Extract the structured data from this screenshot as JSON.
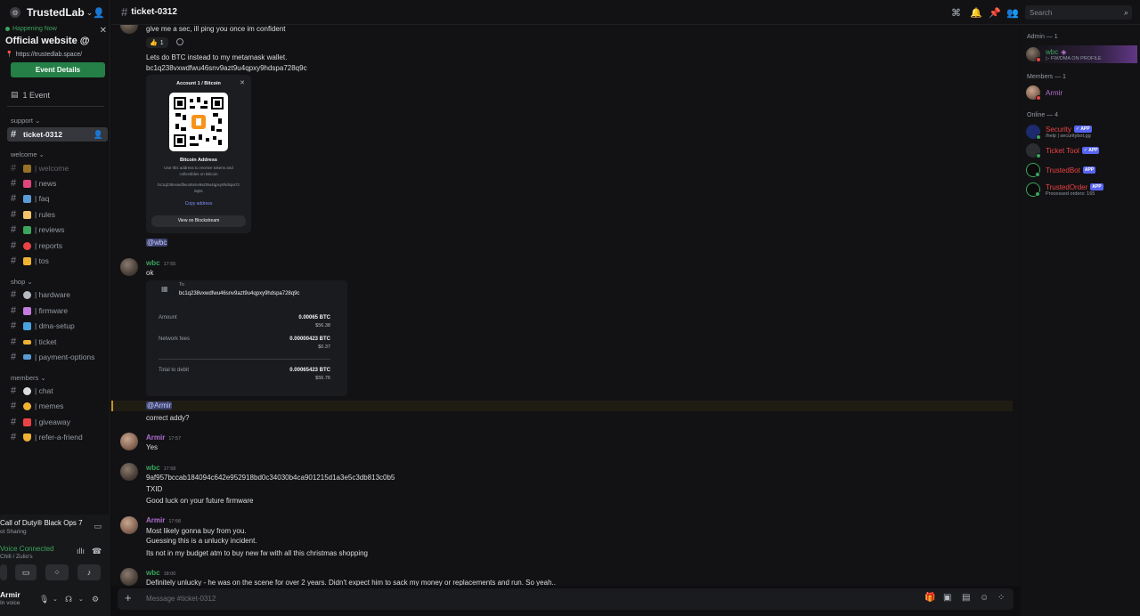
{
  "server": {
    "name": "TrustedLab"
  },
  "event": {
    "status": "Happening Now",
    "title": "Official website @",
    "url": "https://trustedlab.space/",
    "button": "Event Details",
    "count": "1 Event"
  },
  "categories": {
    "support": "support",
    "welcome": "welcome",
    "shop": "shop",
    "members": "members"
  },
  "channels": {
    "active": "ticket-0312",
    "welcome": [
      "| welcome",
      "| news",
      "| faq",
      "| rules",
      "| reviews",
      "| reports",
      "| tos"
    ],
    "shop": [
      "| hardware",
      "| firmware",
      "| dma-setup",
      "| ticket",
      "| payment-options"
    ],
    "members": [
      "| chat",
      "| memes",
      "| giveaway",
      "| refer-a-friend"
    ]
  },
  "activity": {
    "game": "Call of Duty® Black Ops 7",
    "sub": "ot Sharing"
  },
  "voice": {
    "status": "Voice Connected",
    "channel": "Chill / Zulio's"
  },
  "user": {
    "name": "Armir",
    "status": "In voice"
  },
  "header": {
    "channel": "ticket-0312",
    "search_placeholder": "Search"
  },
  "messages": {
    "m1": "give me a sec, ill ping you once im confident",
    "reaction_count": "1",
    "m2": "Lets do BTC instead to my metamask wallet.",
    "m3": "bc1q238vxwdfwu46snv9azt9u4qpxy9hdspa728q9c",
    "wallet": {
      "title": "Account 1 / Bitcoin",
      "label": "Bitcoin Address",
      "desc": "Use this address to receive tokens and collectibles on Bitcoin",
      "address": "bc1q238vxwdfwu46snv9azt9u4qpxy9hdspa728q9c",
      "copy": "Copy address",
      "view": "View on Blockstream"
    },
    "mention1": "@wbc",
    "wbc1_author": "wbc",
    "wbc1_time": "17:55",
    "wbc1_text": "ok",
    "tx": {
      "to_label": "To",
      "to_addr": "bc1q238vxwdfwu46snv9azt9u4qpxy9hdspa728q9c",
      "amount_label": "Amount",
      "amount": "0.00065 BTC",
      "amount_usd": "$56.38",
      "fee_label": "Network fees",
      "fee": "0.00000423 BTC",
      "fee_usd": "$0.37",
      "total_label": "Total to debit",
      "total": "0.00065423 BTC",
      "total_usd": "$56.76"
    },
    "mention2": "@Armir",
    "addy": "correct addy?",
    "armir1_author": "Armir",
    "armir1_time": "17:57",
    "armir1_text": "Yes",
    "wbc2_author": "wbc",
    "wbc2_time": "17:58",
    "wbc2_text1": "9af957bccab184094c642e952918bd0c34030b4ca901215d1a3e5c3db813c0b5",
    "wbc2_text2": "TXID",
    "wbc2_text3": "Good luck on your future firmware",
    "armir2_author": "Armir",
    "armir2_time": "17:58",
    "armir2_text1": "Most likely gonna buy from you.",
    "armir2_text2": "Guessing this is a unlucky incident.",
    "armir2_text3": "Its not in my budget atm to buy new fw with all this christmas shopping",
    "wbc3_author": "wbc",
    "wbc3_time": "18:00",
    "wbc3_text1": "Definitely unlucky - he was on the scene for over 2 years. Didn't expect him to sack my money or replacements and run. So yeah.."
  },
  "composer": {
    "placeholder": "Message #ticket-0312"
  },
  "member_list": {
    "admin_header": "Admin — 1",
    "members_header": "Members — 1",
    "online_header": "Online — 4",
    "admin": {
      "name": "wbc",
      "status": "FW/DMA ON PROFILE"
    },
    "member": {
      "name": "Armir"
    },
    "online": [
      {
        "name": "Security",
        "badge": "APP",
        "status": "/help | securitybot.gg"
      },
      {
        "name": "Ticket Tool",
        "badge": "APP",
        "status": ""
      },
      {
        "name": "TrustedBot",
        "badge": "APP",
        "status": ""
      },
      {
        "name": "TrustedOrder",
        "badge": "APP",
        "status": "Processed orders: 165"
      }
    ]
  },
  "colors": {
    "accent": "#5865f2",
    "online": "#3ba55d",
    "wbc": "#3ba55d",
    "armir": "#b070d0",
    "bots": "#ed4245"
  }
}
